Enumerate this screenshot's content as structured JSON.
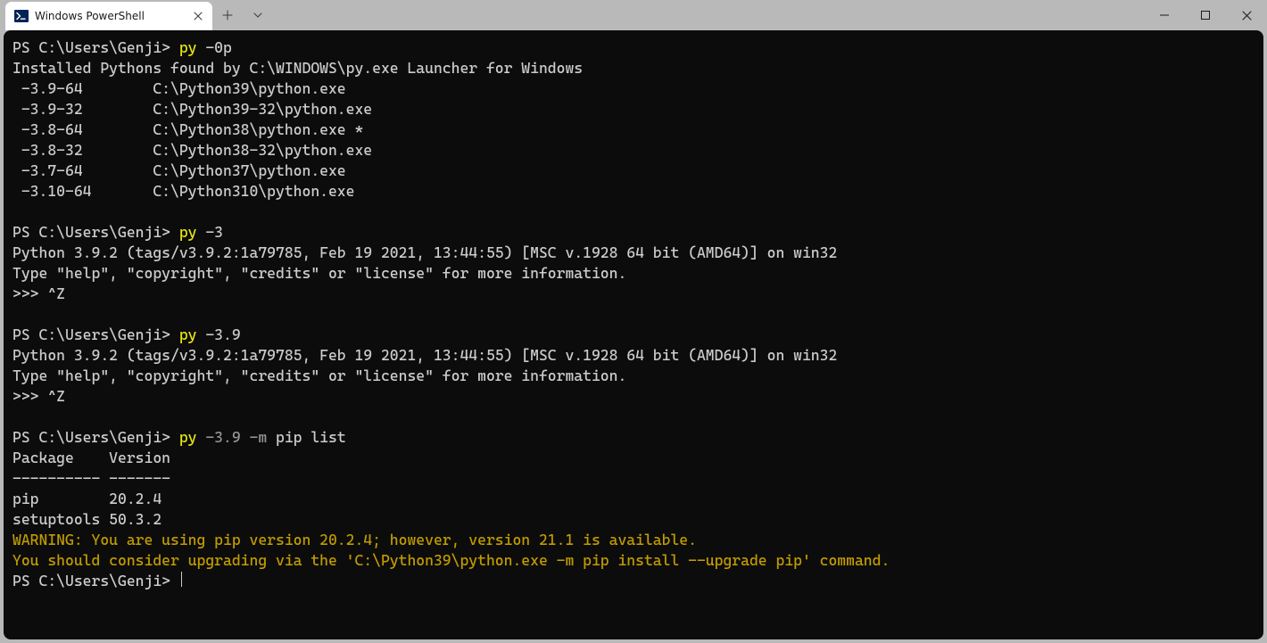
{
  "window": {
    "tab_title": "Windows PowerShell",
    "icon": "powershell-icon"
  },
  "terminal": {
    "blocks": [
      {
        "type": "prompt",
        "prefix": "PS C:\\Users\\Genji> ",
        "cmd_yellow": "py ",
        "cmd_rest": "-0p"
      },
      {
        "type": "out",
        "text": "Installed Pythons found by C:\\WINDOWS\\py.exe Launcher for Windows"
      },
      {
        "type": "out",
        "text": " -3.9-64        C:\\Python39\\python.exe"
      },
      {
        "type": "out",
        "text": " -3.9-32        C:\\Python39-32\\python.exe"
      },
      {
        "type": "out",
        "text": " -3.8-64        C:\\Python38\\python.exe *"
      },
      {
        "type": "out",
        "text": " -3.8-32        C:\\Python38-32\\python.exe"
      },
      {
        "type": "out",
        "text": " -3.7-64        C:\\Python37\\python.exe"
      },
      {
        "type": "out",
        "text": " -3.10-64       C:\\Python310\\python.exe"
      },
      {
        "type": "out",
        "text": " "
      },
      {
        "type": "prompt",
        "prefix": "PS C:\\Users\\Genji> ",
        "cmd_yellow": "py ",
        "cmd_rest": "-3"
      },
      {
        "type": "out",
        "text": "Python 3.9.2 (tags/v3.9.2:1a79785, Feb 19 2021, 13:44:55) [MSC v.1928 64 bit (AMD64)] on win32"
      },
      {
        "type": "out",
        "text": "Type \"help\", \"copyright\", \"credits\" or \"license\" for more information."
      },
      {
        "type": "out",
        "text": ">>> ^Z"
      },
      {
        "type": "out",
        "text": " "
      },
      {
        "type": "prompt",
        "prefix": "PS C:\\Users\\Genji> ",
        "cmd_yellow": "py ",
        "cmd_rest": "-3.9"
      },
      {
        "type": "out",
        "text": "Python 3.9.2 (tags/v3.9.2:1a79785, Feb 19 2021, 13:44:55) [MSC v.1928 64 bit (AMD64)] on win32"
      },
      {
        "type": "out",
        "text": "Type \"help\", \"copyright\", \"credits\" or \"license\" for more information."
      },
      {
        "type": "out",
        "text": ">>> ^Z"
      },
      {
        "type": "out",
        "text": " "
      },
      {
        "type": "prompt",
        "prefix": "PS C:\\Users\\Genji> ",
        "cmd_yellow": "py ",
        "cmd_gray": "-3.9 -m ",
        "cmd_rest": "pip list"
      },
      {
        "type": "out",
        "text": "Package    Version"
      },
      {
        "type": "out",
        "text": "---------- -------"
      },
      {
        "type": "out",
        "text": "pip        20.2.4"
      },
      {
        "type": "out",
        "text": "setuptools 50.3.2"
      },
      {
        "type": "warn",
        "text": "WARNING: You are using pip version 20.2.4; however, version 21.1 is available."
      },
      {
        "type": "warn",
        "text": "You should consider upgrading via the 'C:\\Python39\\python.exe -m pip install --upgrade pip' command."
      },
      {
        "type": "prompt-cursor",
        "prefix": "PS C:\\Users\\Genji> "
      }
    ]
  }
}
